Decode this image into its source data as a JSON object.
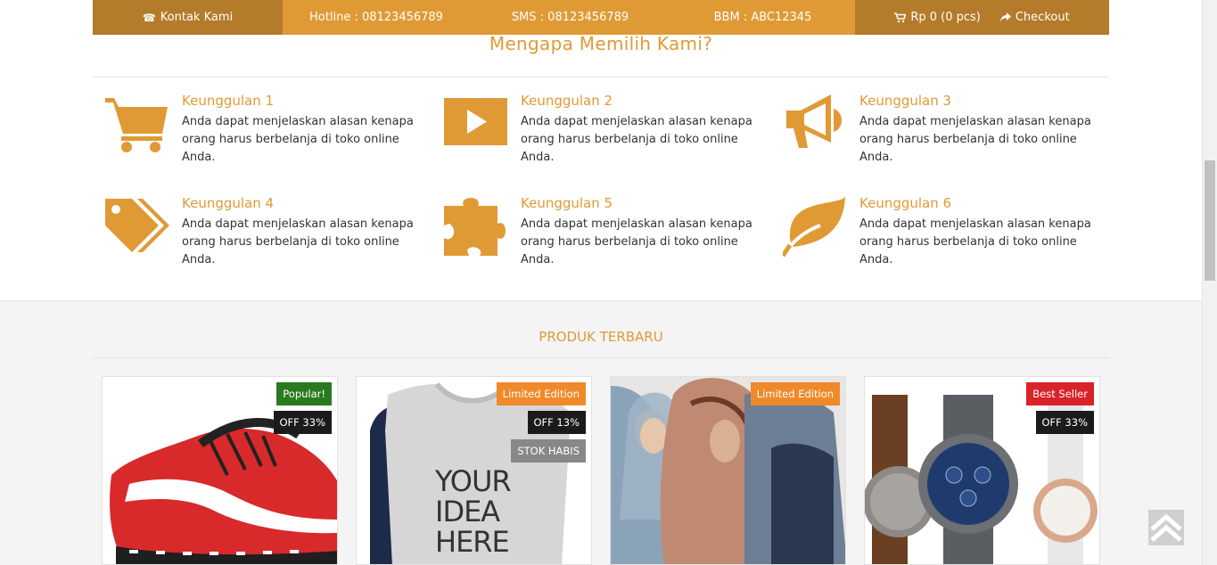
{
  "topbar": {
    "contact_label": "Kontak Kami",
    "hotline": "Hotline : 08123456789",
    "sms": "SMS : 08123456789",
    "bbm": "BBM : ABC12345",
    "cart": "Rp 0 (0 pcs)",
    "checkout": "Checkout"
  },
  "why": {
    "title": "Mengapa Memilih Kami?",
    "features": [
      {
        "title": "Keunggulan 1",
        "desc": "Anda dapat menjelaskan alasan kenapa orang harus berbelanja di toko online Anda.",
        "icon": "cart-icon"
      },
      {
        "title": "Keunggulan 2",
        "desc": "Anda dapat menjelaskan alasan kenapa orang harus berbelanja di toko online Anda.",
        "icon": "play-icon"
      },
      {
        "title": "Keunggulan 3",
        "desc": "Anda dapat menjelaskan alasan kenapa orang harus berbelanja di toko online Anda.",
        "icon": "megaphone-icon"
      },
      {
        "title": "Keunggulan 4",
        "desc": "Anda dapat menjelaskan alasan kenapa orang harus berbelanja di toko online Anda.",
        "icon": "tags-icon"
      },
      {
        "title": "Keunggulan 5",
        "desc": "Anda dapat menjelaskan alasan kenapa orang harus berbelanja di toko online Anda.",
        "icon": "puzzle-icon"
      },
      {
        "title": "Keunggulan 6",
        "desc": "Anda dapat menjelaskan alasan kenapa orang harus berbelanja di toko online Anda.",
        "icon": "leaf-icon"
      }
    ]
  },
  "products": {
    "title": "PRODUK TERBARU",
    "items": [
      {
        "badge": "Popular!",
        "discount": "OFF 33%",
        "stock": "",
        "image": "sneaker"
      },
      {
        "badge": "Limited Edition",
        "discount": "OFF 13%",
        "stock": "STOK HABIS",
        "image_text": [
          "YOUR",
          "IDEA",
          "HERE"
        ]
      },
      {
        "badge": "Limited Edition",
        "discount": "",
        "stock": "",
        "image": "hijab models"
      },
      {
        "badge": "Best Seller",
        "discount": "OFF 33%",
        "stock": "",
        "image": "watches"
      }
    ]
  },
  "colors": {
    "accent": "#e09a35",
    "accent_dark": "#b47b2a"
  }
}
